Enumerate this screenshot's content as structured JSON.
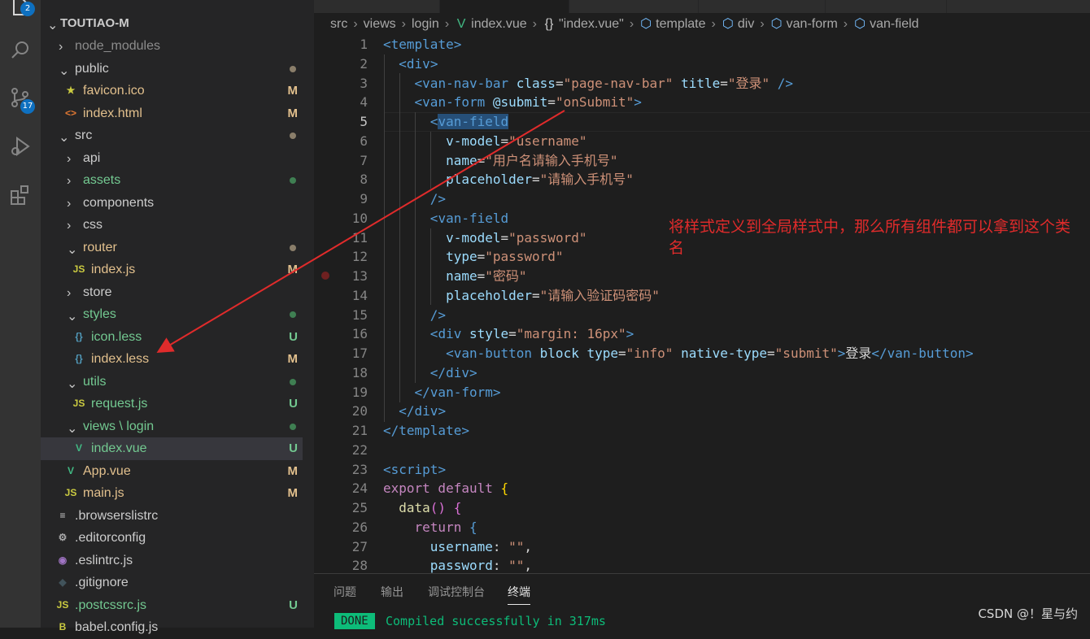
{
  "activity_bar": {
    "explorer_badge": "2",
    "scm_badge": "17",
    "items": [
      "explorer-icon",
      "search-icon",
      "source-control-icon",
      "run-debug-icon",
      "extensions-icon"
    ]
  },
  "explorer": {
    "root_label": "TOUTIAO-M",
    "tree": [
      {
        "label": "node_modules",
        "type": "folder",
        "expanded": false,
        "depth": 1,
        "color": "#8c8c8c",
        "status": "",
        "dot": ""
      },
      {
        "label": "public",
        "type": "folder",
        "expanded": true,
        "depth": 1,
        "color": "#cccccc",
        "status": "",
        "dot": "#8a7e6a"
      },
      {
        "label": "favicon.ico",
        "type": "file",
        "icon": "favicon-star-icon",
        "depth": 2,
        "color": "#e2c08d",
        "status": "M",
        "status_color": "#e2c08d"
      },
      {
        "label": "index.html",
        "type": "file",
        "icon": "html-file-icon",
        "depth": 2,
        "color": "#e2c08d",
        "status": "M",
        "status_color": "#e2c08d"
      },
      {
        "label": "src",
        "type": "folder",
        "expanded": true,
        "depth": 1,
        "color": "#cccccc",
        "status": "",
        "dot": "#8a7e6a"
      },
      {
        "label": "api",
        "type": "folder",
        "expanded": false,
        "depth": 2,
        "color": "#cccccc",
        "status": "",
        "dot": ""
      },
      {
        "label": "assets",
        "type": "folder",
        "expanded": false,
        "depth": 2,
        "color": "#73c991",
        "status": "",
        "dot": "#3f7f52"
      },
      {
        "label": "components",
        "type": "folder",
        "expanded": false,
        "depth": 2,
        "color": "#cccccc",
        "status": "",
        "dot": ""
      },
      {
        "label": "css",
        "type": "folder",
        "expanded": false,
        "depth": 2,
        "color": "#cccccc",
        "status": "",
        "dot": ""
      },
      {
        "label": "router",
        "type": "folder",
        "expanded": true,
        "depth": 2,
        "color": "#e2c08d",
        "status": "",
        "dot": "#8a7e6a"
      },
      {
        "label": "index.js",
        "type": "file",
        "icon": "js-file-icon",
        "depth": 3,
        "color": "#e2c08d",
        "status": "M",
        "status_color": "#e2c08d"
      },
      {
        "label": "store",
        "type": "folder",
        "expanded": false,
        "depth": 2,
        "color": "#cccccc",
        "status": "",
        "dot": ""
      },
      {
        "label": "styles",
        "type": "folder",
        "expanded": true,
        "depth": 2,
        "color": "#73c991",
        "status": "",
        "dot": "#3f7f52"
      },
      {
        "label": "icon.less",
        "type": "file",
        "icon": "less-file-icon",
        "depth": 3,
        "color": "#73c991",
        "status": "U",
        "status_color": "#73c991"
      },
      {
        "label": "index.less",
        "type": "file",
        "icon": "less-file-icon",
        "depth": 3,
        "color": "#e2c08d",
        "status": "M",
        "status_color": "#e2c08d"
      },
      {
        "label": "utils",
        "type": "folder",
        "expanded": true,
        "depth": 2,
        "color": "#73c991",
        "status": "",
        "dot": "#3f7f52"
      },
      {
        "label": "request.js",
        "type": "file",
        "icon": "js-file-icon",
        "depth": 3,
        "color": "#73c991",
        "status": "U",
        "status_color": "#73c991"
      },
      {
        "label": "views \\ login",
        "type": "folder",
        "expanded": true,
        "depth": 2,
        "color": "#73c991",
        "status": "",
        "dot": "#3f7f52"
      },
      {
        "label": "index.vue",
        "type": "file",
        "icon": "vue-file-icon",
        "depth": 3,
        "color": "#73c991",
        "status": "U",
        "status_color": "#73c991",
        "selected": true
      },
      {
        "label": "App.vue",
        "type": "file",
        "icon": "vue-file-icon",
        "depth": 2,
        "color": "#e2c08d",
        "status": "M",
        "status_color": "#e2c08d"
      },
      {
        "label": "main.js",
        "type": "file",
        "icon": "js-file-icon",
        "depth": 2,
        "color": "#e2c08d",
        "status": "M",
        "status_color": "#e2c08d"
      },
      {
        "label": ".browserslistrc",
        "type": "file",
        "icon": "list-file-icon",
        "depth": 1,
        "color": "#cccccc",
        "status": ""
      },
      {
        "label": ".editorconfig",
        "type": "file",
        "icon": "gear-file-icon",
        "depth": 1,
        "color": "#cccccc",
        "status": ""
      },
      {
        "label": ".eslintrc.js",
        "type": "file",
        "icon": "eslint-file-icon",
        "depth": 1,
        "color": "#cccccc",
        "status": ""
      },
      {
        "label": ".gitignore",
        "type": "file",
        "icon": "git-file-icon",
        "depth": 1,
        "color": "#cccccc",
        "status": ""
      },
      {
        "label": ".postcssrc.js",
        "type": "file",
        "icon": "js-file-icon",
        "depth": 1,
        "color": "#73c991",
        "status": "U",
        "status_color": "#73c991"
      },
      {
        "label": "babel.config.js",
        "type": "file",
        "icon": "babel-file-icon",
        "depth": 1,
        "color": "#cccccc",
        "status": ""
      }
    ]
  },
  "breadcrumb": [
    "src",
    "views",
    "login",
    "index.vue",
    "\"index.vue\"",
    "template",
    "div",
    "van-form",
    "van-field"
  ],
  "editor": {
    "current_line": 5,
    "breakpoint_line": 13,
    "lines": [
      [
        [
          "<",
          "t-tag"
        ],
        [
          "template",
          "t-tag"
        ],
        [
          ">",
          "t-tag"
        ]
      ],
      [
        [
          "  ",
          "t-txt"
        ],
        [
          "<",
          "t-tag"
        ],
        [
          "div",
          "t-tag"
        ],
        [
          ">",
          "t-tag"
        ]
      ],
      [
        [
          "    ",
          "t-txt"
        ],
        [
          "<",
          "t-tag"
        ],
        [
          "van-nav-bar",
          "t-tag"
        ],
        [
          " class",
          "t-attr"
        ],
        [
          "=",
          "t-txt"
        ],
        [
          "\"page-nav-bar\"",
          "t-str"
        ],
        [
          " title",
          "t-attr"
        ],
        [
          "=",
          "t-txt"
        ],
        [
          "\"登录\"",
          "t-str"
        ],
        [
          " />",
          "t-tag"
        ]
      ],
      [
        [
          "    ",
          "t-txt"
        ],
        [
          "<",
          "t-tag"
        ],
        [
          "van-form",
          "t-tag"
        ],
        [
          " @submit",
          "t-attr"
        ],
        [
          "=",
          "t-txt"
        ],
        [
          "\"onSubmit\"",
          "t-str"
        ],
        [
          ">",
          "t-tag"
        ]
      ],
      [
        [
          "      ",
          "t-txt"
        ],
        [
          "<",
          "t-tag"
        ],
        [
          "van-field",
          "t-tag hl"
        ]
      ],
      [
        [
          "        v-model",
          "t-attr"
        ],
        [
          "=",
          "t-txt"
        ],
        [
          "\"username\"",
          "t-str"
        ]
      ],
      [
        [
          "        name",
          "t-attr"
        ],
        [
          "=",
          "t-txt"
        ],
        [
          "\"用户名请输入手机号\"",
          "t-str"
        ]
      ],
      [
        [
          "        placeholder",
          "t-attr"
        ],
        [
          "=",
          "t-txt"
        ],
        [
          "\"请输入手机号\"",
          "t-str"
        ]
      ],
      [
        [
          "      ",
          "t-txt"
        ],
        [
          "/>",
          "t-tag"
        ]
      ],
      [
        [
          "      ",
          "t-txt"
        ],
        [
          "<",
          "t-tag"
        ],
        [
          "van-field",
          "t-tag"
        ]
      ],
      [
        [
          "        v-model",
          "t-attr"
        ],
        [
          "=",
          "t-txt"
        ],
        [
          "\"password\"",
          "t-str"
        ]
      ],
      [
        [
          "        type",
          "t-attr"
        ],
        [
          "=",
          "t-txt"
        ],
        [
          "\"password\"",
          "t-str"
        ]
      ],
      [
        [
          "        name",
          "t-attr"
        ],
        [
          "=",
          "t-txt"
        ],
        [
          "\"密码\"",
          "t-str"
        ]
      ],
      [
        [
          "        placeholder",
          "t-attr"
        ],
        [
          "=",
          "t-txt"
        ],
        [
          "\"请输入验证码密码\"",
          "t-str"
        ]
      ],
      [
        [
          "      ",
          "t-txt"
        ],
        [
          "/>",
          "t-tag"
        ]
      ],
      [
        [
          "      ",
          "t-txt"
        ],
        [
          "<",
          "t-tag"
        ],
        [
          "div",
          "t-tag"
        ],
        [
          " style",
          "t-attr"
        ],
        [
          "=",
          "t-txt"
        ],
        [
          "\"margin: 16px\"",
          "t-str"
        ],
        [
          ">",
          "t-tag"
        ]
      ],
      [
        [
          "        ",
          "t-txt"
        ],
        [
          "<",
          "t-tag"
        ],
        [
          "van-button",
          "t-tag"
        ],
        [
          " block",
          "t-attr"
        ],
        [
          " type",
          "t-attr"
        ],
        [
          "=",
          "t-txt"
        ],
        [
          "\"info\"",
          "t-str"
        ],
        [
          " native-type",
          "t-attr"
        ],
        [
          "=",
          "t-txt"
        ],
        [
          "\"submit\"",
          "t-str"
        ],
        [
          ">",
          "t-tag"
        ],
        [
          "登录",
          "t-txt"
        ],
        [
          "</",
          "t-tag"
        ],
        [
          "van-button",
          "t-tag"
        ],
        [
          ">",
          "t-tag"
        ]
      ],
      [
        [
          "      ",
          "t-txt"
        ],
        [
          "</",
          "t-tag"
        ],
        [
          "div",
          "t-tag"
        ],
        [
          ">",
          "t-tag"
        ]
      ],
      [
        [
          "    ",
          "t-txt"
        ],
        [
          "</",
          "t-tag"
        ],
        [
          "van-form",
          "t-tag"
        ],
        [
          ">",
          "t-tag"
        ]
      ],
      [
        [
          "  ",
          "t-txt"
        ],
        [
          "</",
          "t-tag"
        ],
        [
          "div",
          "t-tag"
        ],
        [
          ">",
          "t-tag"
        ]
      ],
      [
        [
          "</",
          "t-tag"
        ],
        [
          "template",
          "t-tag"
        ],
        [
          ">",
          "t-tag"
        ]
      ],
      [],
      [
        [
          "<",
          "t-tag"
        ],
        [
          "script",
          "t-tag"
        ],
        [
          ">",
          "t-tag"
        ]
      ],
      [
        [
          "export",
          "t-ctl"
        ],
        [
          " default ",
          "t-ctl"
        ],
        [
          "{",
          "t-br"
        ]
      ],
      [
        [
          "  ",
          "t-txt"
        ],
        [
          "data",
          "t-fn"
        ],
        [
          "() ",
          "t-br2"
        ],
        [
          "{",
          "t-br2"
        ]
      ],
      [
        [
          "    ",
          "t-txt"
        ],
        [
          "return",
          "t-ctl"
        ],
        [
          " ",
          "t-txt"
        ],
        [
          "{",
          "t-kw"
        ]
      ],
      [
        [
          "      username",
          "t-attr"
        ],
        [
          ": ",
          "t-txt"
        ],
        [
          "\"\"",
          "t-str"
        ],
        [
          ",",
          "t-txt"
        ]
      ],
      [
        [
          "      password",
          "t-attr"
        ],
        [
          ": ",
          "t-txt"
        ],
        [
          "\"\"",
          "t-str"
        ],
        [
          ",",
          "t-txt"
        ]
      ]
    ]
  },
  "annotation": "将样式定义到全局样式中，那么所有组件都可以拿到这个类名",
  "panel": {
    "tabs": [
      "问题",
      "输出",
      "调试控制台",
      "终端"
    ],
    "active_tab": "终端",
    "done_badge": "DONE",
    "compiled_text": "Compiled successfully in 317ms"
  },
  "watermark": "CSDN @！星与约"
}
